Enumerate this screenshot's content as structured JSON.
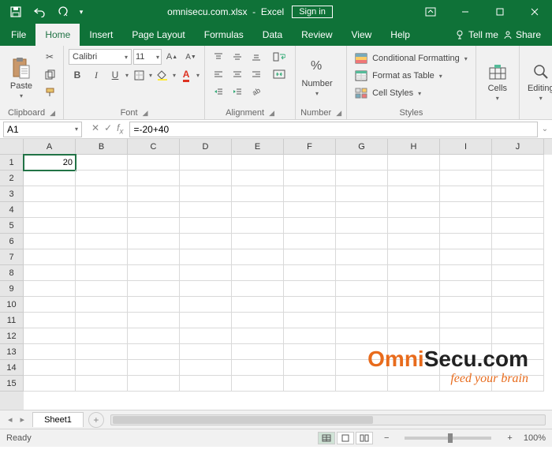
{
  "title": {
    "filename": "omnisecu.com.xlsx",
    "app": "Excel",
    "signin": "Sign in"
  },
  "tabs": {
    "file": "File",
    "home": "Home",
    "insert": "Insert",
    "pagelayout": "Page Layout",
    "formulas": "Formulas",
    "data": "Data",
    "review": "Review",
    "view": "View",
    "help": "Help",
    "tellme": "Tell me",
    "share": "Share"
  },
  "ribbon": {
    "clipboard": {
      "paste": "Paste",
      "label": "Clipboard"
    },
    "font": {
      "name": "Calibri",
      "size": "11",
      "label": "Font"
    },
    "alignment": {
      "label": "Alignment"
    },
    "number": {
      "btn": "Number",
      "label": "Number"
    },
    "styles": {
      "cond": "Conditional Formatting",
      "table": "Format as Table",
      "cell": "Cell Styles",
      "label": "Styles"
    },
    "cells": {
      "btn": "Cells",
      "label": ""
    },
    "editing": {
      "btn": "Editing",
      "label": ""
    }
  },
  "formula": {
    "namebox": "A1",
    "value": "=-20+40"
  },
  "grid": {
    "cols": [
      "A",
      "B",
      "C",
      "D",
      "E",
      "F",
      "G",
      "H",
      "I",
      "J"
    ],
    "rows": [
      "1",
      "2",
      "3",
      "4",
      "5",
      "6",
      "7",
      "8",
      "9",
      "10",
      "11",
      "12",
      "13",
      "14",
      "15"
    ],
    "a1": "20"
  },
  "watermark": {
    "brand_pre": "Omni",
    "brand_post": "Secu.com",
    "tag": "feed your brain"
  },
  "sheettabs": {
    "sheet": "Sheet1"
  },
  "status": {
    "ready": "Ready",
    "zoom": "100%"
  }
}
